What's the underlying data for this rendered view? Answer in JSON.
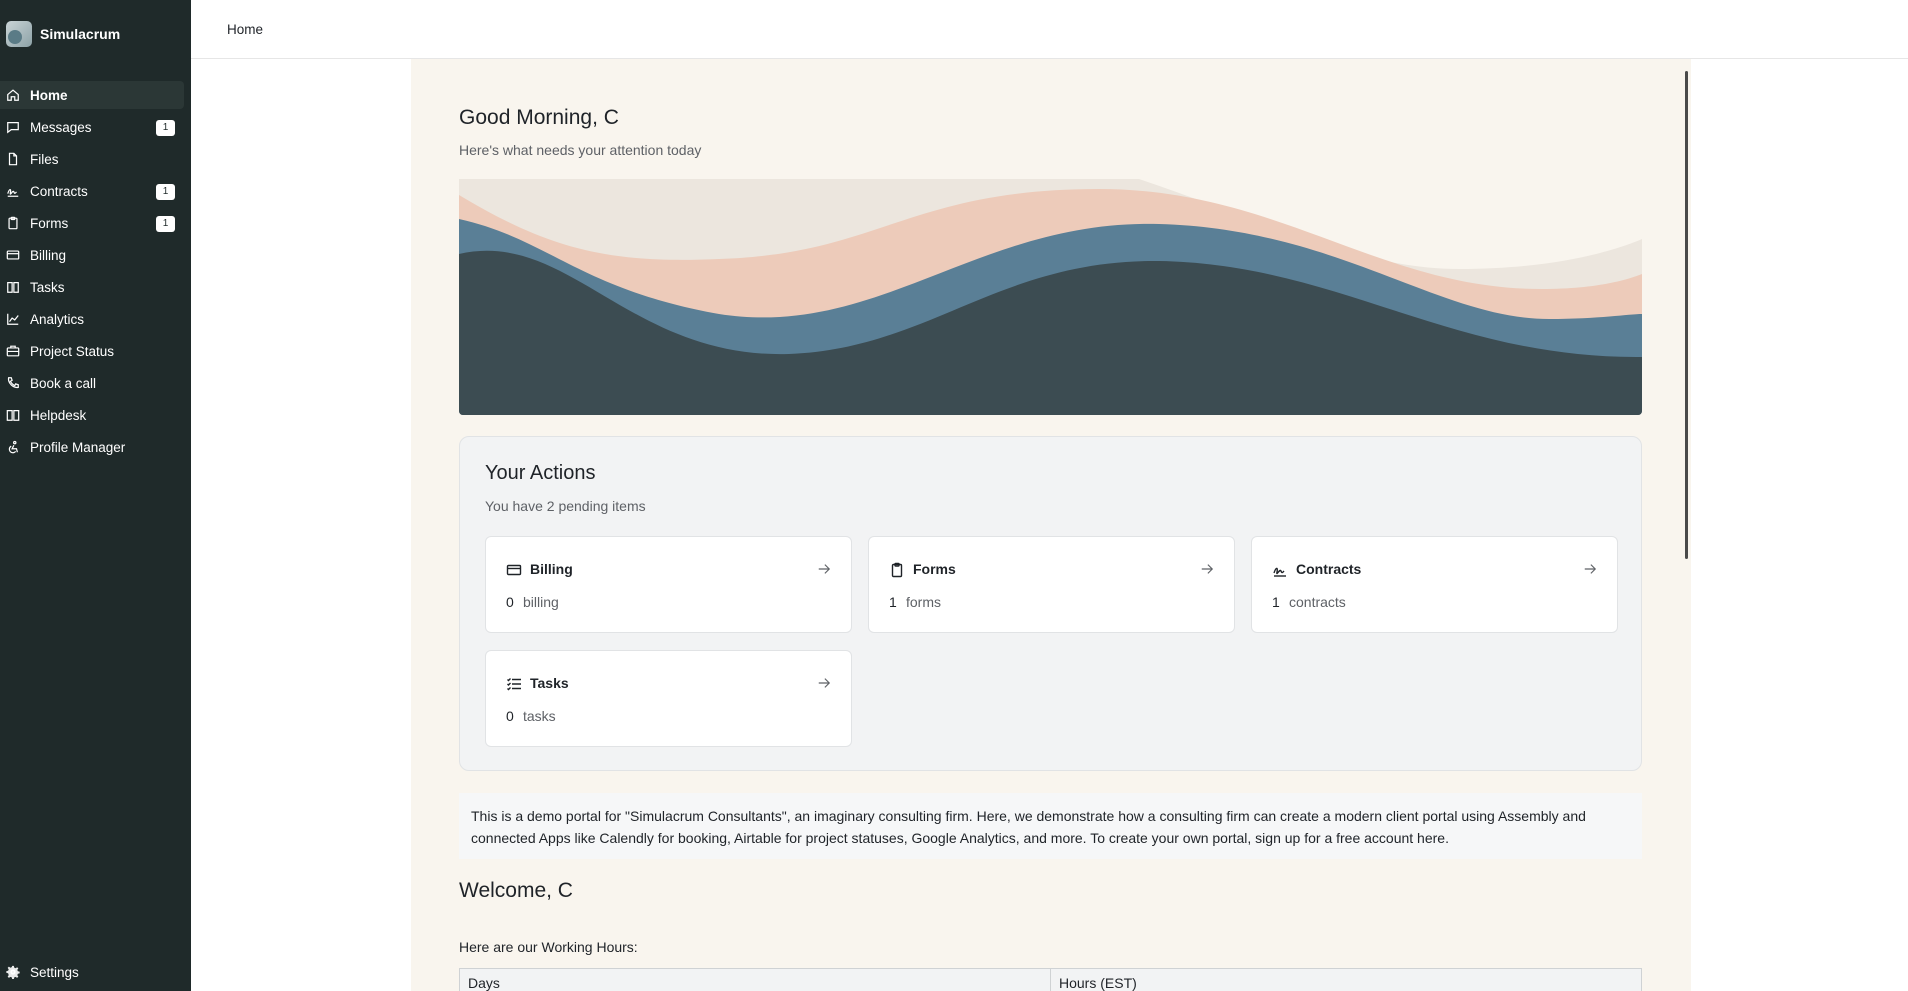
{
  "brand": {
    "name": "Simulacrum"
  },
  "sidebar": {
    "items": [
      {
        "label": "Home",
        "icon": "home-icon",
        "active": true
      },
      {
        "label": "Messages",
        "icon": "message-icon",
        "badge": "1"
      },
      {
        "label": "Files",
        "icon": "file-icon"
      },
      {
        "label": "Contracts",
        "icon": "signature-icon",
        "badge": "1"
      },
      {
        "label": "Forms",
        "icon": "clipboard-icon",
        "badge": "1"
      },
      {
        "label": "Billing",
        "icon": "credit-card-icon"
      },
      {
        "label": "Tasks",
        "icon": "book-icon"
      },
      {
        "label": "Analytics",
        "icon": "chart-line-icon"
      },
      {
        "label": "Project Status",
        "icon": "briefcase-icon"
      },
      {
        "label": "Book a call",
        "icon": "phone-icon"
      },
      {
        "label": "Helpdesk",
        "icon": "book-open-icon"
      },
      {
        "label": "Profile Manager",
        "icon": "accessibility-icon"
      }
    ],
    "settings_label": "Settings"
  },
  "topbar": {
    "title": "Home"
  },
  "greeting": {
    "title": "Good Morning, C",
    "subtitle": "Here's what needs your attention today"
  },
  "hero": {
    "colors": [
      "#ece6de",
      "#edcbba",
      "#5a7f96",
      "#3c4c52"
    ]
  },
  "actions": {
    "title": "Your Actions",
    "subtitle": "You have 2 pending items",
    "cards": [
      {
        "title": "Billing",
        "count": "0",
        "unit": "billing",
        "icon": "credit-card-icon"
      },
      {
        "title": "Forms",
        "count": "1",
        "unit": "forms",
        "icon": "clipboard-icon"
      },
      {
        "title": "Contracts",
        "count": "1",
        "unit": "contracts",
        "icon": "signature-icon"
      },
      {
        "title": "Tasks",
        "count": "0",
        "unit": "tasks",
        "icon": "list-checks-icon"
      }
    ]
  },
  "demo_text": "This is a demo portal for \"Simulacrum Consultants\", an imaginary consulting firm. Here, we demonstrate how a consulting firm can create a modern client portal using Assembly and connected Apps like Calendly for booking, Airtable for project statuses, Google Analytics, and more. To create your own portal, sign up for a free account here.",
  "welcome": {
    "title": "Welcome, C"
  },
  "working_hours": {
    "intro": "Here are our Working Hours:",
    "columns": [
      "Days",
      "Hours (EST)"
    ]
  },
  "colors": {
    "sidebar_bg": "#1f2a2a",
    "content_bg": "#f9f5ee"
  }
}
